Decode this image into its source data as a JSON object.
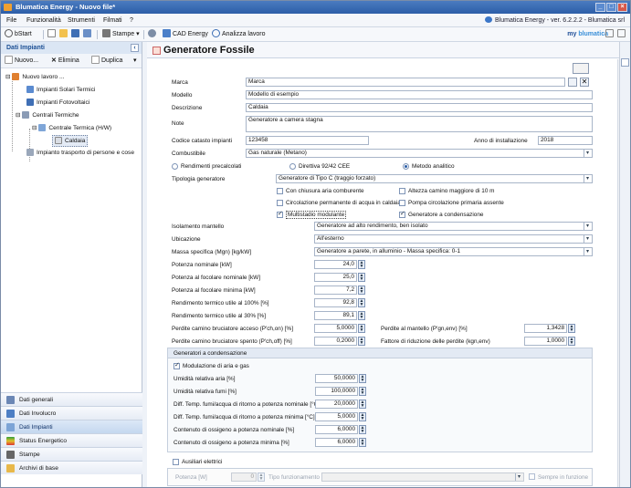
{
  "window": {
    "title": "Blumatica Energy - Nuovo file*",
    "version_text": "Blumatica Energy - ver. 6.2.2.2 - Blumatica srl"
  },
  "menu": {
    "items": [
      "File",
      "Funzionalità",
      "Strumenti",
      "Filmati",
      "?"
    ]
  },
  "toolbar": {
    "bstart": "bStart",
    "stampe": "Stampe",
    "cad": "CAD Energy",
    "analizza": "Analizza lavoro",
    "brand_a": "my",
    "brand_b": "blumatica"
  },
  "left": {
    "header": "Dati Impianti",
    "nuovo": "Nuovo...",
    "elimina": "Elimina",
    "duplica": "Duplica",
    "tree": {
      "root": "Nuovo lavoro ...",
      "solari": "Impianti Solari Termici",
      "fotovoltaici": "Impianti Fotovoltaici",
      "centrali": "Centrali Termiche",
      "centrale": "Centrale Termica (H/W)",
      "caldaia": "Caldaia",
      "trasporto": "Impianto trasporto di persone e cose"
    },
    "nav": [
      "Dati generali",
      "Dati Involucro",
      "Dati Impianti",
      "Status Energetico",
      "Stampe",
      "Archivi di base"
    ]
  },
  "main": {
    "title": "Generatore Fossile",
    "marca_label": "Marca",
    "marca_value": "Marca",
    "modello_label": "Modello",
    "modello_value": "Modello di esempio",
    "descrizione_label": "Descrizione",
    "descrizione_value": "Caldaia",
    "note_label": "Note",
    "note_value": "Generatore a camera stagna",
    "catasto_label": "Codice catasto impianti",
    "catasto_value": "123458",
    "anno_label": "Anno di installazione",
    "anno_value": "2018",
    "combustibile_label": "Combustibile",
    "combustibile_value": "Gas naturale (Metano)",
    "radio_precalcolati": "Rendimenti precalcolati",
    "radio_direttiva": "Direttiva 92/42 CEE",
    "radio_metodo": "Metodo analitico",
    "tipologia_label": "Tipologia generatore",
    "tipologia_value": "Generatore di Tipo C (traggio forzato)",
    "checks": {
      "aria_comburente": "Con chiusura aria comburente",
      "altezza_camino": "Altezza camino maggiore di 10 m",
      "circolazione": "Circolazione permanente di acqua in caldaia",
      "pompa": "Pompa circolazione primaria assente",
      "multistadio": "Multistadio modulante",
      "condensazione": "Generatore a condensazione"
    },
    "isolamento_label": "Isolamento mantello",
    "isolamento_value": "Generatore ad alto rendimento, ben isolato",
    "ubicazione_label": "Ubicazione",
    "ubicazione_value": "All'esterno",
    "massa_label": "Massa specifica (Mgn) [kg/kW]",
    "massa_value": "Generatore a parete, in alluminio - Massa specifica: 0-1",
    "pot_nom_label": "Potenza nominale [kW]",
    "pot_nom_value": "24,0",
    "pot_foc_nom_label": "Potenza al focolare nominale [kW]",
    "pot_foc_nom_value": "25,0",
    "pot_foc_min_label": "Potenza al focolare minima [kW]",
    "pot_foc_min_value": "7,2",
    "rend_100_label": "Rendimento termico utile al 100% [%]",
    "rend_100_value": "92,8",
    "rend_30_label": "Rendimento termico utile al 30% [%]",
    "rend_30_value": "89,1",
    "perd_acc_label": "Perdite camino bruciatore acceso (P'ch,on) [%]",
    "perd_acc_value": "5,0000",
    "perd_spe_label": "Perdite camino bruciatore spento (P'ch,off) [%]",
    "perd_spe_value": "0,2000",
    "perd_mant_label": "Perdite al mantello (P'gn,env) [%]",
    "perd_mant_value": "1,3428",
    "fatt_rid_label": "Fattore di riduzione delle perdite (kgn,env)",
    "fatt_rid_value": "1,0000",
    "cond_group": "Generatori a condensazione",
    "modulazione_label": "Modulazione di aria e gas",
    "umid_aria_label": "Umidità relativa aria [%]",
    "umid_aria_value": "50,0000",
    "umid_fumi_label": "Umidità relativa fumi [%]",
    "umid_fumi_value": "100,0000",
    "diff_nom_label": "Diff. Temp. fumi/acqua di ritorno a potenza nominale [°C]",
    "diff_nom_value": "20,0000",
    "diff_min_label": "Diff. Temp. fumi/acqua di ritorno a potenza minima [°C]",
    "diff_min_value": "5,0000",
    "oss_nom_label": "Contenuto di ossigeno a potenza nominale [%]",
    "oss_nom_value": "6,0000",
    "oss_min_label": "Contenuto di ossigeno a potenza minima [%]",
    "oss_min_value": "6,0000",
    "ausiliari_label": "Ausiliari elettrici",
    "potenza_label": "Potenza [W]",
    "potenza_value": "0",
    "tipo_funz_label": "Tipo funzionamento",
    "sempre_label": "Sempre in funzione"
  },
  "colors": {
    "accent": "#2d5ea8",
    "titlebar": "#3b6db5"
  }
}
